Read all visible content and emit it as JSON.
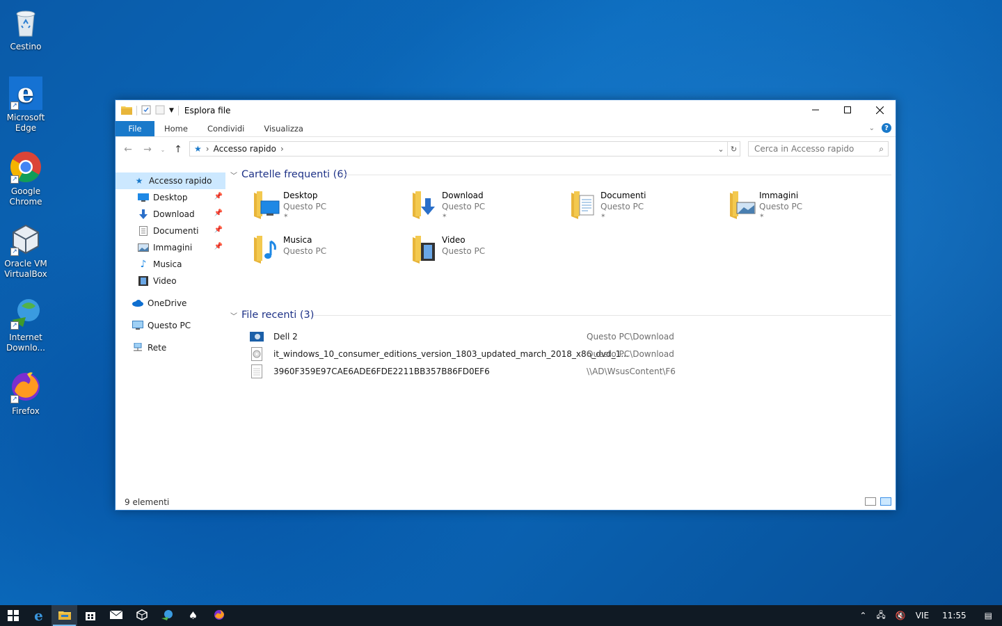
{
  "desktop": {
    "icons": [
      {
        "label": "Cestino"
      },
      {
        "label": "Microsoft Edge"
      },
      {
        "label": "Google Chrome"
      },
      {
        "label": "Oracle VM VirtualBox"
      },
      {
        "label": "Internet Downlo..."
      },
      {
        "label": "Firefox"
      }
    ]
  },
  "window": {
    "title": "Esplora file",
    "ribbon_tabs": [
      "File",
      "Home",
      "Condividi",
      "Visualizza"
    ],
    "address_path": "Accesso rapido",
    "search_placeholder": "Cerca in Accesso rapido",
    "sidebar": [
      {
        "label": "Accesso rapido"
      },
      {
        "label": "Desktop"
      },
      {
        "label": "Download"
      },
      {
        "label": "Documenti"
      },
      {
        "label": "Immagini"
      },
      {
        "label": "Musica"
      },
      {
        "label": "Video"
      },
      {
        "label": "OneDrive"
      },
      {
        "label": "Questo PC"
      },
      {
        "label": "Rete"
      }
    ],
    "frequent_header": "Cartelle frequenti (6)",
    "frequent": [
      {
        "name": "Desktop",
        "location": "Questo PC",
        "pinned": true
      },
      {
        "name": "Download",
        "location": "Questo PC",
        "pinned": true
      },
      {
        "name": "Documenti",
        "location": "Questo PC",
        "pinned": true
      },
      {
        "name": "Immagini",
        "location": "Questo PC",
        "pinned": true
      },
      {
        "name": "Musica",
        "location": "Questo PC",
        "pinned": false
      },
      {
        "name": "Video",
        "location": "Questo PC",
        "pinned": false
      }
    ],
    "recent_header": "File recenti (3)",
    "recent": [
      {
        "name": "Dell 2",
        "path": "Questo PC\\Download"
      },
      {
        "name": "it_windows_10_consumer_editions_version_1803_updated_march_2018_x86_dvd_1...",
        "path": "Questo PC\\Download"
      },
      {
        "name": "3960F359E97CAE6ADE6FDE2211BB357B86FD0EF6",
        "path": "\\\\AD\\WsusContent\\F6"
      }
    ],
    "status": "9 elementi"
  },
  "taskbar": {
    "lang": "VIE",
    "time": "11:55"
  },
  "colors": {
    "accent": "#1979ca",
    "selection": "#cce8ff",
    "taskbar": "#101a24",
    "folder": "#f3c94f"
  }
}
